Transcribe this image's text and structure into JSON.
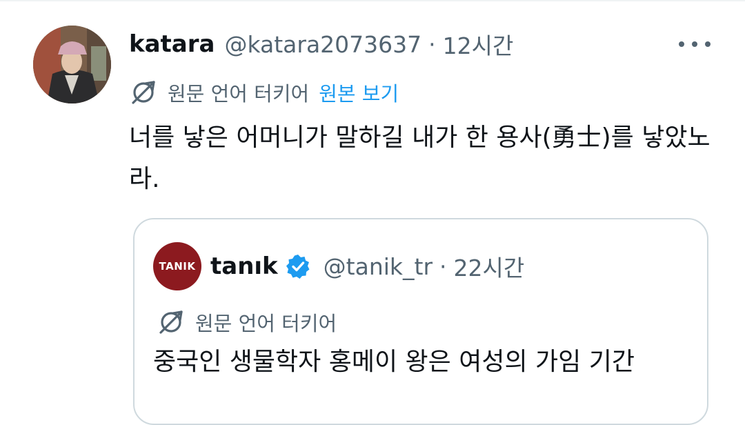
{
  "tweet": {
    "author_name": "katara",
    "author_handle": "@katara2073637",
    "separator": "·",
    "time": "12시간",
    "translation_label": "원문 언어 터키어",
    "show_original": "원본 보기",
    "text": "너를 낳은 어머니가 말하길 내가 한 용사(勇士)를 낳았노라."
  },
  "quote": {
    "avatar_text": "TANIK",
    "author_name": "tanık",
    "author_handle": "@tanik_tr",
    "separator": "·",
    "time": "22시간",
    "translation_label": "원문 언어 터키어",
    "text": "중국인 생물학자 홍메이 왕은 여성의 가임 기간"
  },
  "colors": {
    "text_primary": "#0f1419",
    "text_secondary": "#536471",
    "link_blue": "#1d9bf0",
    "verified_blue": "#1d9bf0",
    "border": "#cfd9de",
    "tanik_red": "#8c1a1f"
  },
  "icons": {
    "translate": "translate-globe-icon",
    "more": "more-dots-icon",
    "verified": "verified-badge-icon"
  }
}
